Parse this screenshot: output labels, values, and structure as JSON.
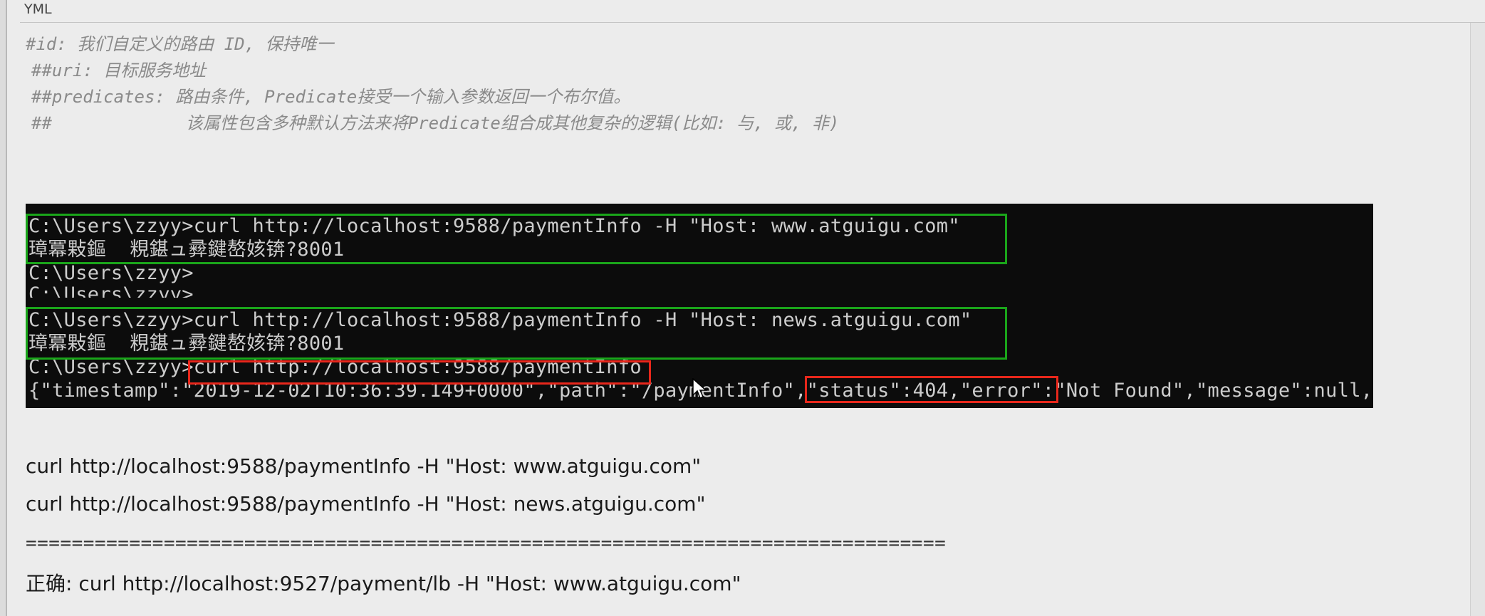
{
  "editor": {
    "language": "YML"
  },
  "comments": [
    "#id: 我们自定义的路由 ID, 保持唯一",
    "##uri: 目标服务地址",
    "##predicates: 路由条件, Predicate接受一个输入参数返回一个布尔值。",
    "##             该属性包含多种默认方法来将Predicate组合成其他复杂的逻辑(比如: 与, 或, 非)"
  ],
  "terminal": {
    "lines": [
      "C:\\Users\\zzyy>curl http://localhost:9588/paymentInfo -H \"Host: www.atguigu.com\"",
      "璋冪敤鏂  粯鍖ュ彛鍵嶅姟锛?8001",
      "C:\\Users\\zzyy>",
      "C:\\Users\\zzyy>",
      "C:\\Users\\zzyy>curl http://localhost:9588/paymentInfo -H \"Host: news.atguigu.com\"",
      "璋冪敤鏂  粯鍖ュ彛鍵嶅姟锛?8001",
      "C:\\Users\\zzyy>curl http://localhost:9588/paymentInfo",
      "{\"timestamp\":\"2019-12-02T10:36:39.149+0000\",\"path\":\"/paymentInfo\",\"status\":404,\"error\":\"Not Found\",\"message\":null,"
    ]
  },
  "notes": {
    "line1": "curl http://localhost:9588/paymentInfo -H \"Host: www.atguigu.com\"",
    "line2": "curl http://localhost:9588/paymentInfo -H \"Host: news.atguigu.com\"",
    "divider": "================================================================================",
    "correct": "正确: curl http://localhost:9527/payment/lb -H \"Host: www.atguigu.com\""
  },
  "icons": {
    "cursor": "mouse-pointer-icon"
  },
  "colors": {
    "terminal_bg": "#0c0c0c",
    "terminal_text": "#cccccc",
    "highlight_green": "#1aa51a",
    "highlight_red": "#e8271b",
    "comment_text": "#8a8a8a"
  }
}
